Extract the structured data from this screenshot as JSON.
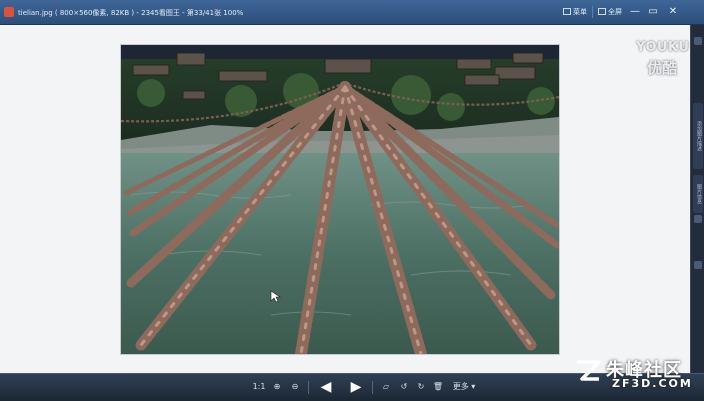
{
  "window": {
    "title": "tielian.jpg ( 800×560像素, 82KB ) - 2345看图王 - 第33/41张 100%",
    "actions": [
      {
        "label": "菜单",
        "icon": "menu-icon"
      },
      {
        "label": "全屏",
        "icon": "fullscreen-icon"
      }
    ],
    "controls": [
      {
        "label": "—",
        "icon": "minimize-icon"
      },
      {
        "label": "▭",
        "icon": "restore-icon"
      },
      {
        "label": "✕",
        "icon": "close-icon"
      }
    ]
  },
  "side_panel": {
    "tabs": [
      "添加图片描述",
      "图片信息"
    ]
  },
  "toolbar": {
    "actual_size_label": "1:1",
    "more_label": "更多",
    "tools": [
      {
        "name": "actual-size-button",
        "label": "1:1"
      },
      {
        "name": "zoom-in-button",
        "label": "⊕"
      },
      {
        "name": "zoom-out-button",
        "label": "⊖"
      },
      {
        "name": "previous-button",
        "label": "🡄"
      },
      {
        "name": "next-button",
        "label": "🡆"
      },
      {
        "name": "comment-button",
        "label": "▱"
      },
      {
        "name": "rotate-left-button",
        "label": "↺"
      },
      {
        "name": "rotate-right-button",
        "label": "↻"
      },
      {
        "name": "delete-button",
        "label": "🗑"
      }
    ]
  },
  "watermarks": {
    "youku_en": "YOUKU",
    "youku_cn": "优酷",
    "zf_cn": "朱峰社区",
    "zf_en": "ZF3D.COM"
  },
  "photo": {
    "description_icon": "photo-chain-bridge"
  },
  "colors": {
    "titlebar": "#2b4f7c",
    "viewer_bg": "#f2f4f6",
    "toolbar": "#1c2735",
    "accent_red": "#d9523a"
  }
}
